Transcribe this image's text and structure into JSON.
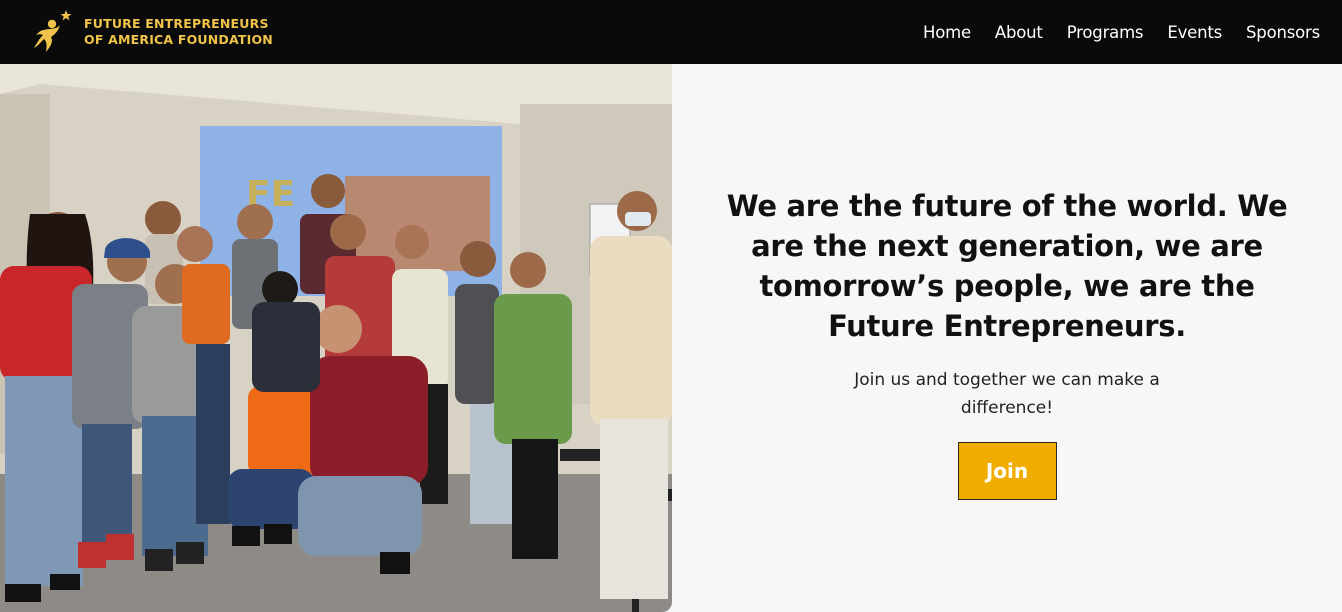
{
  "header": {
    "logo_icon": "running-star-figure-icon",
    "brand_line1": "FUTURE ENTREPRENEURS",
    "brand_line2": "OF AMERICA FOUNDATION",
    "nav": [
      {
        "label": "Home"
      },
      {
        "label": "About"
      },
      {
        "label": "Programs"
      },
      {
        "label": "Events"
      },
      {
        "label": "Sponsors"
      }
    ]
  },
  "hero": {
    "headline": "We are the future of the world. We are the next generation, we are tomorrow’s people, we are the Future Entrepreneurs.",
    "subtext": "Join us and together we can make a difference!",
    "cta_label": "Join"
  },
  "colors": {
    "header_bg": "#0a0a0b",
    "brand_gold": "#f0c44a",
    "cta_bg": "#f0ad00",
    "page_bg": "#f7f7f7"
  }
}
